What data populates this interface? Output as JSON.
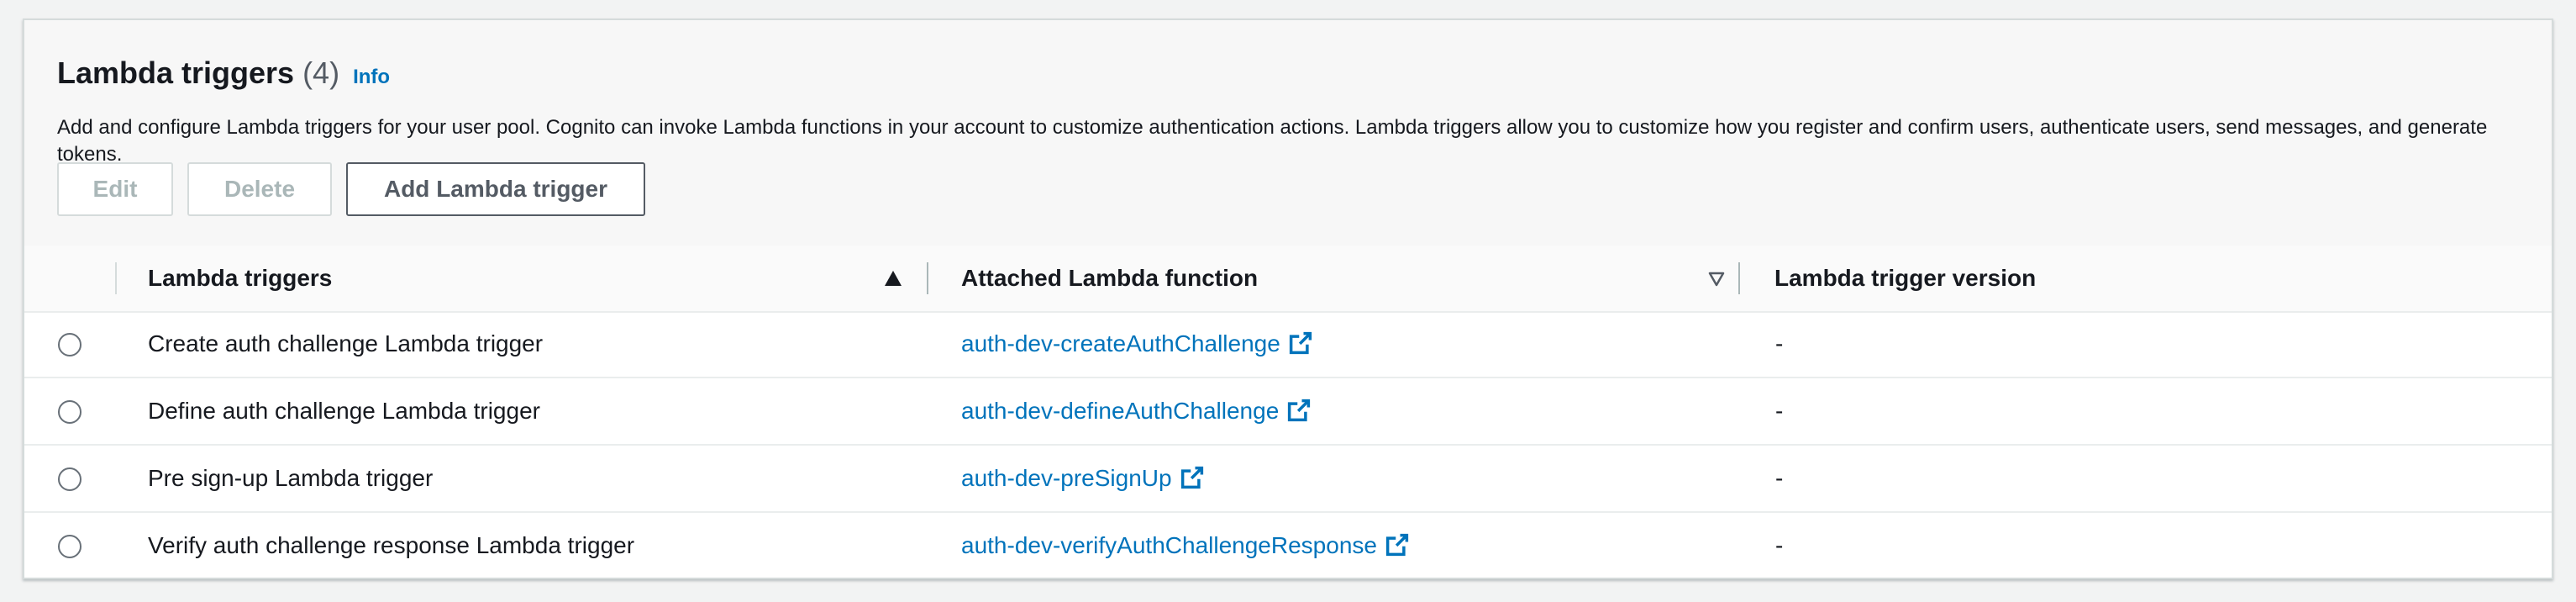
{
  "section": {
    "title": "Lambda triggers",
    "count": "(4)",
    "info_label": "Info",
    "description": "Add and configure Lambda triggers for your user pool. Cognito can invoke Lambda functions in your account to customize authentication actions. Lambda triggers allow you to customize how you register and confirm users, authenticate users, send messages, and generate tokens."
  },
  "toolbar": {
    "edit_label": "Edit",
    "delete_label": "Delete",
    "add_label": "Add Lambda trigger"
  },
  "table": {
    "columns": [
      {
        "label": "Lambda triggers",
        "sort": "ascending"
      },
      {
        "label": "Attached Lambda function",
        "sort": "unsorted"
      },
      {
        "label": "Lambda trigger version"
      }
    ],
    "rows": [
      {
        "trigger": "Create auth challenge Lambda trigger",
        "function": "auth-dev-createAuthChallenge",
        "version": "-",
        "selected": false
      },
      {
        "trigger": "Define auth challenge Lambda trigger",
        "function": "auth-dev-defineAuthChallenge",
        "version": "-",
        "selected": false
      },
      {
        "trigger": "Pre sign-up Lambda trigger",
        "function": "auth-dev-preSignUp",
        "version": "-",
        "selected": false
      },
      {
        "trigger": "Verify auth challenge response Lambda trigger",
        "function": "auth-dev-verifyAuthChallengeResponse",
        "version": "-",
        "selected": false
      }
    ]
  },
  "icons": {
    "external_link": "external-link-icon",
    "sort_ascending": "sort-ascending-icon",
    "sort_unsorted": "sort-descending-outline-icon"
  },
  "colors": {
    "link": "#0073bb",
    "text": "#16191f",
    "muted": "#545b64",
    "disabled": "#aab7b8"
  }
}
